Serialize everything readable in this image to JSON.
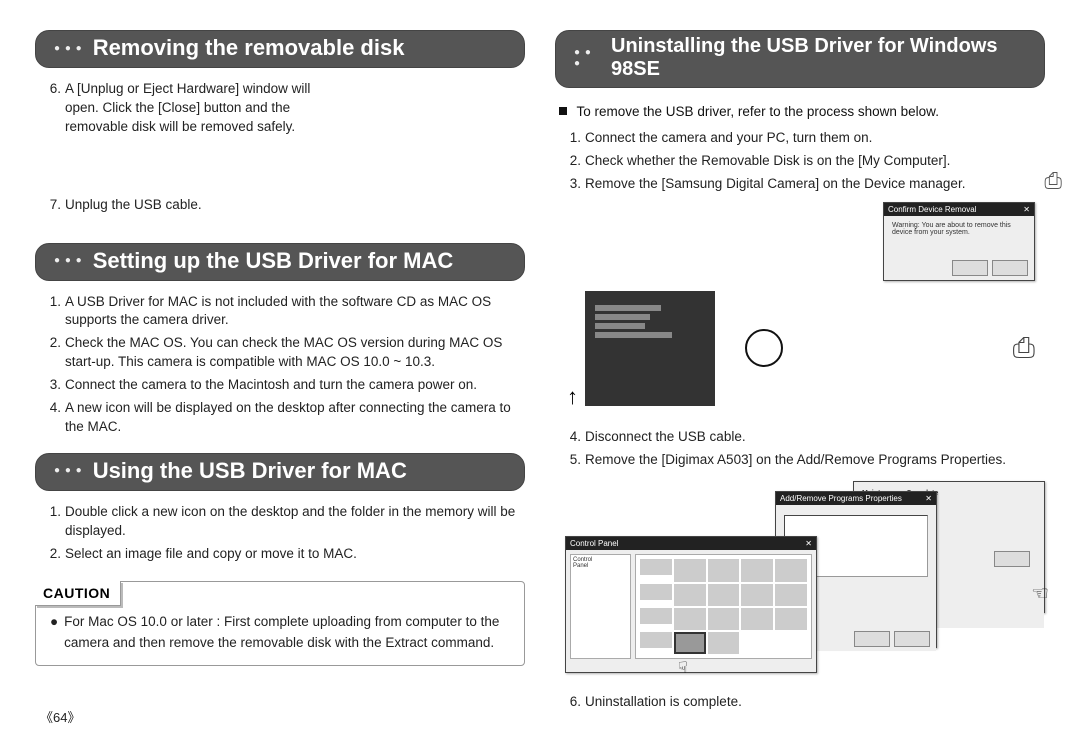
{
  "page_number": "《64》",
  "left": {
    "sec1_title": "Removing the removable disk",
    "sec1_items": [
      {
        "n": "6.",
        "t": "A [Unplug or Eject Hardware] window will open. Click the [Close] button and the removable disk will be removed safely."
      },
      {
        "n": "7.",
        "t": "Unplug the USB cable."
      }
    ],
    "sec2_title": "Setting up the USB Driver for MAC",
    "sec2_items": [
      {
        "n": "1.",
        "t": "A USB Driver for MAC is not included with the software CD as MAC OS supports the camera driver."
      },
      {
        "n": "2.",
        "t": "Check the MAC OS. You can check the MAC OS version during MAC OS start-up.  This camera is compatible with MAC OS 10.0 ~ 10.3."
      },
      {
        "n": "3.",
        "t": "Connect the camera to the Macintosh and turn the camera power on."
      },
      {
        "n": "4.",
        "t": "A new icon will be displayed on the desktop after connecting the camera to the MAC."
      }
    ],
    "sec3_title": "Using the USB Driver for MAC",
    "sec3_items": [
      {
        "n": "1.",
        "t": "Double click a new icon on the desktop and the folder in the memory will be displayed."
      },
      {
        "n": "2.",
        "t": "Select an image file and copy or move it to MAC."
      }
    ],
    "caution_label": "CAUTION",
    "caution_text": "For Mac OS 10.0 or later : First complete uploading from computer to the camera and then remove the removable disk with the Extract command."
  },
  "right": {
    "sec1_title": "Uninstalling the USB Driver for Windows 98SE",
    "lead": "To remove the USB driver, refer to the process shown below.",
    "items_a": [
      {
        "n": "1.",
        "t": "Connect the camera and your PC, turn them on."
      },
      {
        "n": "2.",
        "t": "Check whether the Removable Disk is on the [My Computer]."
      },
      {
        "n": "3.",
        "t": "Remove the [Samsung Digital Camera] on the Device manager."
      }
    ],
    "dialog1_title": "Confirm Device Removal",
    "dialog1_text": "Warning: You are about to remove this device from your system.",
    "items_b": [
      {
        "n": "4.",
        "t": "Disconnect the USB cable."
      },
      {
        "n": "5.",
        "t": "Remove the [Digimax A503] on the Add/Remove Programs Properties."
      }
    ],
    "dialog_props_title": "Add/Remove Programs Properties",
    "dialog_panel_title": "Control Panel",
    "dialog_wiz_title": "Maintenance Complete",
    "items_c": [
      {
        "n": "6.",
        "t": "Uninstallation is complete."
      }
    ]
  }
}
